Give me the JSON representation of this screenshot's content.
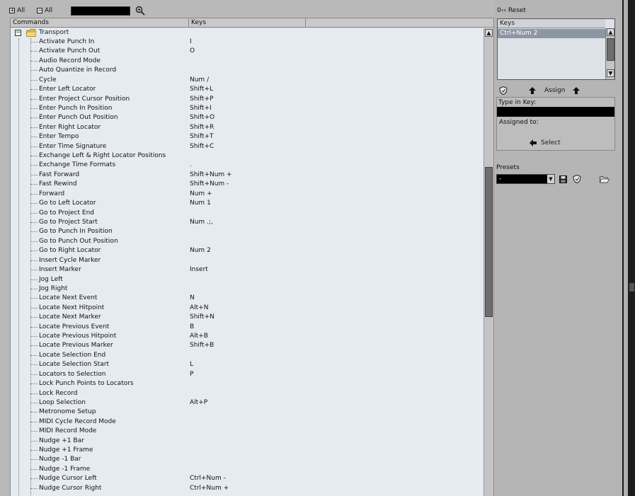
{
  "toolbar": {
    "expand_all": "All",
    "collapse_all": "All",
    "expand_symbol": "+",
    "collapse_symbol": "−"
  },
  "columns": {
    "commands": "Commands",
    "keys": "Keys"
  },
  "tree": {
    "root_label": "Transport",
    "expander_symbol": "−",
    "rows": [
      {
        "name": "Activate Punch In",
        "key": "I"
      },
      {
        "name": "Activate Punch Out",
        "key": "O"
      },
      {
        "name": "Audio Record Mode",
        "key": ""
      },
      {
        "name": "Auto Quantize in Record",
        "key": ""
      },
      {
        "name": "Cycle",
        "key": "Num /"
      },
      {
        "name": "Enter Left Locator",
        "key": "Shift+L"
      },
      {
        "name": "Enter Project Cursor Position",
        "key": "Shift+P"
      },
      {
        "name": "Enter Punch In Position",
        "key": "Shift+I"
      },
      {
        "name": "Enter Punch Out Position",
        "key": "Shift+O"
      },
      {
        "name": "Enter Right Locator",
        "key": "Shift+R"
      },
      {
        "name": "Enter Tempo",
        "key": "Shift+T"
      },
      {
        "name": "Enter Time Signature",
        "key": "Shift+C"
      },
      {
        "name": "Exchange Left & Right Locator Positions",
        "key": ""
      },
      {
        "name": "Exchange Time Formats",
        "key": "."
      },
      {
        "name": "Fast Forward",
        "key": "Shift+Num +"
      },
      {
        "name": "Fast Rewind",
        "key": "Shift+Num -"
      },
      {
        "name": "Forward",
        "key": "Num +"
      },
      {
        "name": "Go to Left Locator",
        "key": "Num 1"
      },
      {
        "name": "Go to Project End",
        "key": ""
      },
      {
        "name": "Go to Project Start",
        "key": "Num .;,"
      },
      {
        "name": "Go to Punch In Position",
        "key": ""
      },
      {
        "name": "Go to Punch Out Position",
        "key": ""
      },
      {
        "name": "Go to Right Locator",
        "key": "Num 2"
      },
      {
        "name": "Insert Cycle Marker",
        "key": ""
      },
      {
        "name": "Insert Marker",
        "key": "Insert"
      },
      {
        "name": "Jog Left",
        "key": ""
      },
      {
        "name": "Jog Right",
        "key": ""
      },
      {
        "name": "Locate Next Event",
        "key": "N"
      },
      {
        "name": "Locate Next Hitpoint",
        "key": "Alt+N"
      },
      {
        "name": "Locate Next Marker",
        "key": "Shift+N"
      },
      {
        "name": "Locate Previous Event",
        "key": "B"
      },
      {
        "name": "Locate Previous Hitpoint",
        "key": "Alt+B"
      },
      {
        "name": "Locate Previous Marker",
        "key": "Shift+B"
      },
      {
        "name": "Locate Selection End",
        "key": ""
      },
      {
        "name": "Locate Selection Start",
        "key": "L"
      },
      {
        "name": "Locators to Selection",
        "key": "P"
      },
      {
        "name": "Lock Punch Points to Locators",
        "key": ""
      },
      {
        "name": "Lock Record",
        "key": ""
      },
      {
        "name": "Loop Selection",
        "key": "Alt+P"
      },
      {
        "name": "Metronome Setup",
        "key": ""
      },
      {
        "name": "MIDI Cycle Record Mode",
        "key": ""
      },
      {
        "name": "MIDI Record Mode",
        "key": ""
      },
      {
        "name": "Nudge +1 Bar",
        "key": ""
      },
      {
        "name": "Nudge +1 Frame",
        "key": ""
      },
      {
        "name": "Nudge -1 Bar",
        "key": ""
      },
      {
        "name": "Nudge -1 Frame",
        "key": ""
      },
      {
        "name": "Nudge Cursor Left",
        "key": "Ctrl+Num -"
      },
      {
        "name": "Nudge Cursor Right",
        "key": "Ctrl+Num +"
      }
    ]
  },
  "right_panel": {
    "reset_label": "Reset",
    "reset_glyph": "0‹‹",
    "keys_header": "Keys",
    "keys_selected": "Ctrl+Num 2",
    "assign_label": "Assign",
    "type_in_key_label": "Type in Key:",
    "assigned_to_label": "Assigned to:",
    "select_label": "Select",
    "presets_label": "Presets",
    "preset_value": "-"
  },
  "scroll": {
    "up_glyph": "▲",
    "down_glyph": "▼"
  }
}
